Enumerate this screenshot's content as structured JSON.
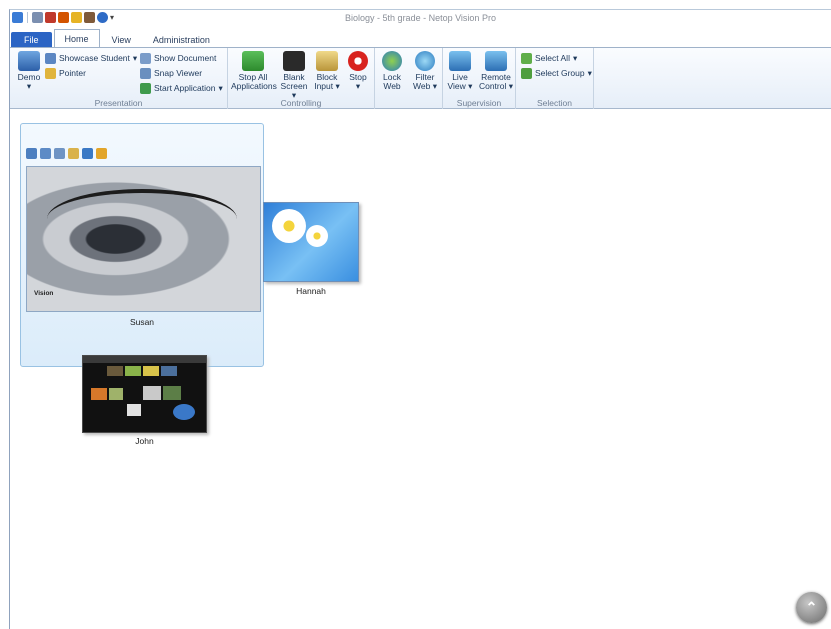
{
  "window": {
    "title": "Biology - 5th grade - Netop Vision Pro"
  },
  "quick_access": [
    "app-icon",
    "grid-icon",
    "presenter-icon",
    "book-icon",
    "shield-icon",
    "tools-icon",
    "help-icon",
    "dropdown-icon"
  ],
  "tabs": [
    {
      "label": "File"
    },
    {
      "label": "Home"
    },
    {
      "label": "View"
    },
    {
      "label": "Administration"
    }
  ],
  "ribbon": {
    "presentation": {
      "label": "Presentation",
      "demo": "Demo",
      "showcase_student": "Showcase Student",
      "pointer": "Pointer",
      "show_document": "Show Document",
      "snap_viewer": "Snap Viewer",
      "start_application": "Start Application"
    },
    "controlling": {
      "label": "Controlling",
      "stop_all_1": "Stop All",
      "stop_all_2": "Applications",
      "blank_1": "Blank",
      "blank_2": "Screen",
      "block_1": "Block",
      "block_2": "Input",
      "stop": "Stop"
    },
    "lock_web": {
      "line1": "Lock",
      "line2": "Web"
    },
    "filter_web": {
      "line1": "Filter",
      "line2": "Web"
    },
    "supervision": {
      "label": "Supervision",
      "live_1": "Live",
      "live_2": "View",
      "remote_1": "Remote",
      "remote_2": "Control"
    },
    "selection": {
      "label": "Selection",
      "select_all": "Select All",
      "select_group": "Select Group"
    }
  },
  "students": [
    {
      "name": "Susan",
      "screen_brand": "Vision"
    },
    {
      "name": "Hannah"
    },
    {
      "name": "John"
    }
  ],
  "colors": {
    "accent": "#2b64c4",
    "selection": "#dbecfa"
  }
}
